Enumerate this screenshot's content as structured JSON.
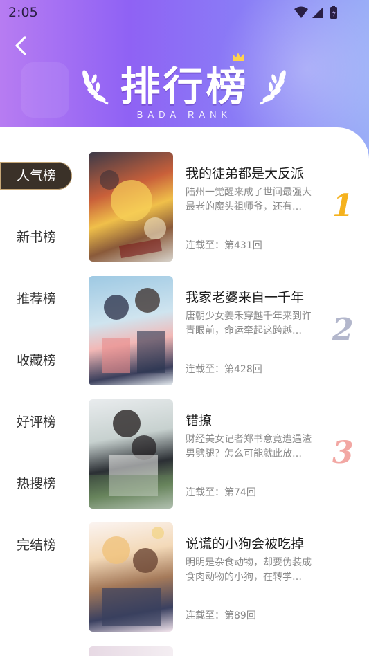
{
  "status": {
    "time": "2:05"
  },
  "header": {
    "title": "排行榜",
    "subtitle": "BADA RANK"
  },
  "sidebar": {
    "items": [
      {
        "label": "人气榜",
        "active": true
      },
      {
        "label": "新书榜",
        "active": false
      },
      {
        "label": "推荐榜",
        "active": false
      },
      {
        "label": "收藏榜",
        "active": false
      },
      {
        "label": "好评榜",
        "active": false
      },
      {
        "label": "热搜榜",
        "active": false
      },
      {
        "label": "完结榜",
        "active": false
      }
    ]
  },
  "list": [
    {
      "title": "我的徒弟都是大反派",
      "desc": "陆州一觉醒来成了世间最强大最老的魔头祖师爷，还有…",
      "progress": "连载至：第431回",
      "rank": "1",
      "rank_color": "#f5b21e"
    },
    {
      "title": "我家老婆来自一千年",
      "desc": "唐朝少女姜禾穿越千年来到许青眼前，命运牵起这跨越…",
      "progress": "连载至：第428回",
      "rank": "2",
      "rank_color": "#b3b7cc"
    },
    {
      "title": "错撩",
      "desc": "财经美女记者郑书意竟遭遇渣男劈腿？怎么可能就此放…",
      "progress": "连载至：第74回",
      "rank": "3",
      "rank_color": "#f2a7a3"
    },
    {
      "title": "说谎的小狗会被吃掉",
      "desc": "明明是杂食动物，却要伪装成食肉动物的小狗，在转学…",
      "progress": "连载至：第89回",
      "rank": "",
      "rank_color": ""
    }
  ],
  "colors": {
    "header_start": "#b77cf2",
    "header_end": "#9aaef7",
    "active_tab": "#3a3128",
    "accent_gold": "#c7a878"
  }
}
